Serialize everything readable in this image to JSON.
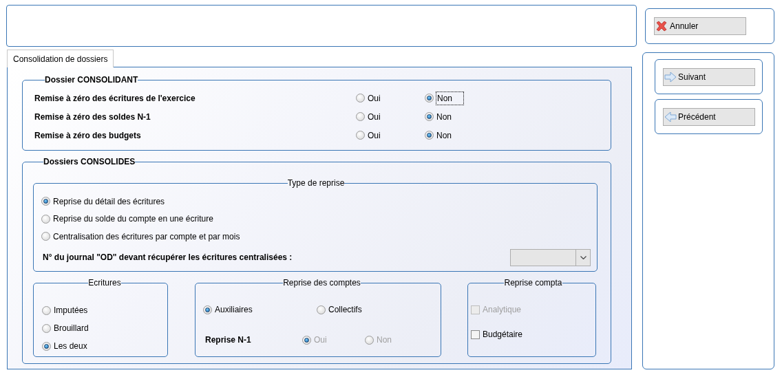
{
  "actions": {
    "cancel": "Annuler"
  },
  "tabs": [
    {
      "label": "Consolidation de dossiers",
      "selected": true
    }
  ],
  "consolidant": {
    "title": "Dossier CONSOLIDANT",
    "rows": [
      {
        "label": "Remise à zéro des écritures de l'exercice",
        "options": [
          {
            "label": "Oui",
            "selected": false,
            "focused": false
          },
          {
            "label": "Non",
            "selected": true,
            "focused": true
          }
        ]
      },
      {
        "label": "Remise à zéro des soldes N-1",
        "options": [
          {
            "label": "Oui",
            "selected": false,
            "focused": false
          },
          {
            "label": "Non",
            "selected": true,
            "focused": false
          }
        ]
      },
      {
        "label": "Remise à zéro des budgets",
        "options": [
          {
            "label": "Oui",
            "selected": false,
            "focused": false
          },
          {
            "label": "Non",
            "selected": true,
            "focused": false
          }
        ]
      }
    ]
  },
  "consolides": {
    "title": "Dossiers CONSOLIDES",
    "type_de_reprise": {
      "title": "Type de reprise",
      "options": [
        {
          "label": "Reprise du détail des écritures",
          "selected": true
        },
        {
          "label": "Reprise du solde du compte en une écriture",
          "selected": false
        },
        {
          "label": "Centralisation des écritures par compte et par mois",
          "selected": false
        }
      ],
      "journal_label": "N° du journal \"OD\" devant récupérer les écritures centralisées :"
    },
    "ecritures": {
      "title": "Ecritures",
      "options": [
        {
          "label": "Imputées",
          "selected": false
        },
        {
          "label": "Brouillard",
          "selected": false
        },
        {
          "label": "Les deux",
          "selected": true
        }
      ]
    },
    "reprise_des_comptes": {
      "title": "Reprise des comptes",
      "options": [
        {
          "label": "Auxiliaires",
          "selected": true
        },
        {
          "label": "Collectifs",
          "selected": false
        }
      ],
      "reprise_n1": {
        "label": "Reprise N-1",
        "disabled": true,
        "options": [
          {
            "label": "Oui",
            "selected": true
          },
          {
            "label": "Non",
            "selected": false
          }
        ]
      }
    },
    "reprise_compta": {
      "title": "Reprise compta",
      "items": [
        {
          "label": "Analytique",
          "checked": false,
          "disabled": true
        },
        {
          "label": "Budgétaire",
          "checked": false,
          "disabled": false
        }
      ]
    }
  },
  "nav": [
    {
      "label": "Suivant",
      "kind": "next"
    },
    {
      "label": "Précédent",
      "kind": "prev"
    }
  ]
}
